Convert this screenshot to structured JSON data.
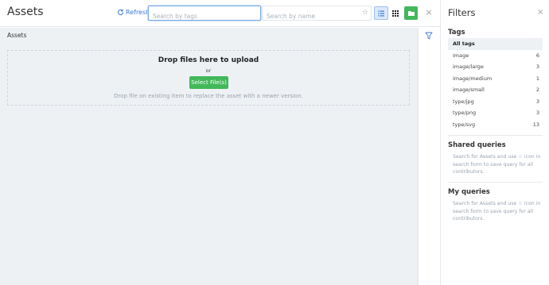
{
  "header": {
    "title": "Assets",
    "refresh_label": "Refresh",
    "search_tags_placeholder": "Search by tags",
    "search_name_placeholder": "Search by name",
    "close_symbol": "×"
  },
  "content": {
    "breadcrumb": "Assets",
    "dropzone": {
      "title": "Drop files here to upload",
      "or": "or",
      "select_button": "Select File(s)",
      "hint": "Drop file on existing item to replace the asset with a newer version."
    }
  },
  "filters": {
    "title": "Filters",
    "close_symbol": "×",
    "tags_heading": "Tags",
    "tags": [
      {
        "label": "All tags",
        "count": ""
      },
      {
        "label": "image",
        "count": "6"
      },
      {
        "label": "image/large",
        "count": "3"
      },
      {
        "label": "image/medium",
        "count": "1"
      },
      {
        "label": "image/small",
        "count": "2"
      },
      {
        "label": "type/jpg",
        "count": "3"
      },
      {
        "label": "type/png",
        "count": "3"
      },
      {
        "label": "type/svg",
        "count": "13"
      }
    ],
    "shared_heading": "Shared queries",
    "shared_text": "Search for Assets and use ☆ icon in search form to save query for all contributors.",
    "my_heading": "My queries",
    "my_text": "Search for Assets and use ☆ icon in search form to save query for all contributors."
  },
  "colors": {
    "accent": "#3b7bd8",
    "success": "#42b85a",
    "content_bg": "#eef1f4"
  },
  "icons": {
    "refresh": "refresh-icon",
    "star": "star-icon",
    "list_view": "list-view-icon",
    "grid_view": "grid-view-icon",
    "folder": "folder-icon",
    "filter": "filter-icon"
  }
}
